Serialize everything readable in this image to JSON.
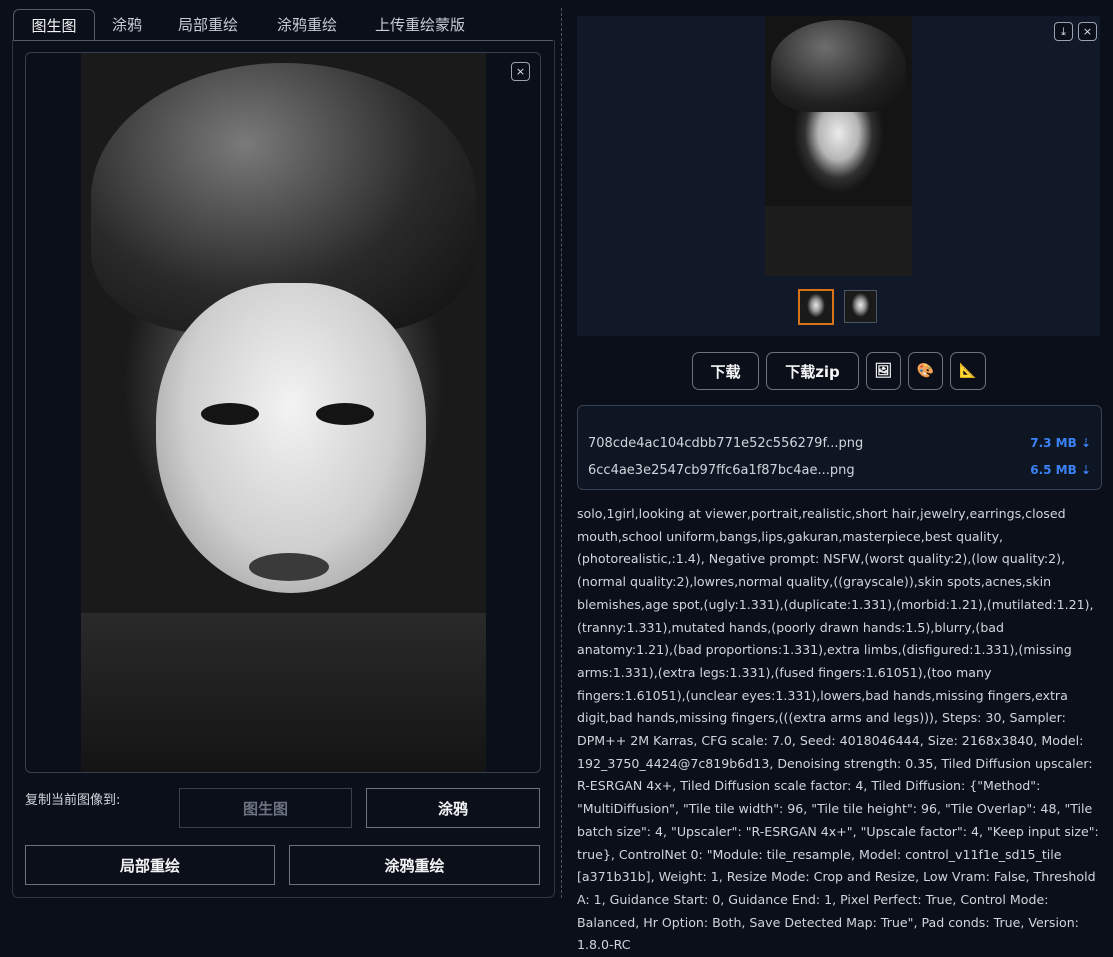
{
  "tabs": [
    {
      "label": "图生图",
      "active": true
    },
    {
      "label": "涂鸦",
      "active": false
    },
    {
      "label": "局部重绘",
      "active": false
    },
    {
      "label": "涂鸦重绘",
      "active": false
    },
    {
      "label": "上传重绘蒙版",
      "active": false
    }
  ],
  "left": {
    "close_icon": "×",
    "copy_label": "复制当前图像到:",
    "buttons": {
      "img2img": "图生图",
      "sketch": "涂鸦",
      "inpaint": "局部重绘",
      "inpaint_sketch": "涂鸦重绘"
    }
  },
  "right": {
    "download_icon": "⤓",
    "close_icon": "×",
    "buttons": {
      "download": "下载",
      "download_zip": "下载zip",
      "image_icon": "🖼",
      "palette_icon": "🎨",
      "ruler_icon": "📐"
    },
    "files": [
      {
        "name": "708cde4ac104cdbb771e52c556279f...png",
        "size": "7.3 MB ⇣"
      },
      {
        "name": "6cc4ae3e2547cb97ffc6a1f87bc4ae...png",
        "size": "6.5 MB ⇣"
      }
    ],
    "generation_info": "solo,1girl,looking at viewer,portrait,realistic,short hair,jewelry,earrings,closed mouth,school uniform,bangs,lips,gakuran,masterpiece,best quality,(photorealistic,:1.4), Negative prompt: NSFW,(worst quality:2),(low quality:2),(normal quality:2),lowres,normal quality,((grayscale)),skin spots,acnes,skin blemishes,age spot,(ugly:1.331),(duplicate:1.331),(morbid:1.21),(mutilated:1.21),(tranny:1.331),mutated hands,(poorly drawn hands:1.5),blurry,(bad anatomy:1.21),(bad proportions:1.331),extra limbs,(disfigured:1.331),(missing arms:1.331),(extra legs:1.331),(fused fingers:1.61051),(too many fingers:1.61051),(unclear eyes:1.331),lowers,bad hands,missing fingers,extra digit,bad hands,missing fingers,(((extra arms and legs))), Steps: 30, Sampler: DPM++ 2M Karras, CFG scale: 7.0, Seed: 4018046444, Size: 2168x3840, Model: 192_3750_4424@7c819b6d13, Denoising strength: 0.35, Tiled Diffusion upscaler: R-ESRGAN 4x+, Tiled Diffusion scale factor: 4, Tiled Diffusion: {\"Method\": \"MultiDiffusion\", \"Tile tile width\": 96, \"Tile tile height\": 96, \"Tile Overlap\": 48, \"Tile batch size\": 4, \"Upscaler\": \"R-ESRGAN 4x+\", \"Upscale factor\": 4, \"Keep input size\": true}, ControlNet 0: \"Module: tile_resample, Model: control_v11f1e_sd15_tile [a371b31b], Weight: 1, Resize Mode: Crop and Resize, Low Vram: False, Threshold A: 1, Guidance Start: 0, Guidance End: 1, Pixel Perfect: True, Control Mode: Balanced, Hr Option: Both, Save Detected Map: True\", Pad conds: True, Version: 1.8.0-RC"
  },
  "colors": {
    "accent_selected": "#d9731a",
    "file_size": "#3b82f6"
  }
}
